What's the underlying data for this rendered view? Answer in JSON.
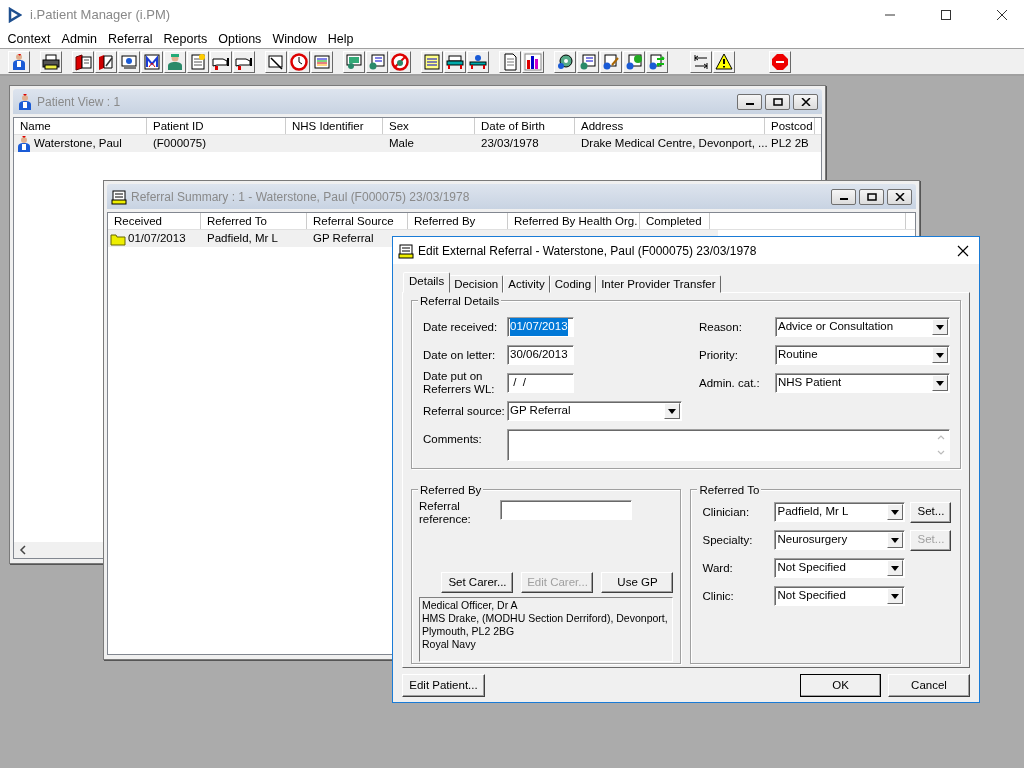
{
  "app": {
    "title": "i.Patient Manager (i.PM)"
  },
  "menu": [
    "Context",
    "Admin",
    "Referral",
    "Reports",
    "Options",
    "Window",
    "Help"
  ],
  "patient_view": {
    "title": "Patient View : 1",
    "columns": [
      "Name",
      "Patient ID",
      "NHS Identifier",
      "Sex",
      "Date of Birth",
      "Address",
      "Postcod"
    ],
    "rows": [
      {
        "selected": true,
        "cells": [
          "Waterstone, Paul",
          "(F000075)",
          null,
          "Male",
          "23/03/1978",
          "Drake Medical Centre, Devonport, ...",
          "PL2 2B"
        ]
      }
    ]
  },
  "referral_summary": {
    "title": "Referral Summary : 1 - Waterstone, Paul (F000075) 23/03/1978",
    "columns": [
      "Received",
      "Referred To",
      "Referral Source",
      "Referred By",
      "Referred By Health Org.",
      "Completed"
    ],
    "rows": [
      {
        "selected": true,
        "cells": [
          "01/07/2013",
          "Padfield, Mr L",
          "GP Referral"
        ]
      }
    ]
  },
  "dialog": {
    "title": "Edit External Referral - Waterstone, Paul (F000075) 23/03/1978",
    "tabs": [
      {
        "label": "Details",
        "selected": true
      },
      {
        "label": "Decision",
        "selected": false
      },
      {
        "label": "Activity",
        "selected": false
      },
      {
        "label": "Coding",
        "selected": false
      },
      {
        "label": "Inter Provider Transfer",
        "selected": false
      }
    ],
    "referral_details": {
      "legend": "Referral Details",
      "left": [
        {
          "kind": "date",
          "label": "Date received:",
          "value": "01/07/2013",
          "highlighted": true
        },
        {
          "kind": "date",
          "label": "Date on letter:",
          "value": "30/06/2013",
          "highlighted": false
        },
        {
          "kind": "date",
          "label": "Date put on Referrers WL:",
          "value": " /  /",
          "highlighted": false
        },
        {
          "kind": "select",
          "label": "Referral source:",
          "value": "GP Referral"
        }
      ],
      "right": [
        {
          "kind": "select",
          "label": "Reason:",
          "value": "Advice or Consultation"
        },
        {
          "kind": "select",
          "label": "Priority:",
          "value": "Routine"
        },
        {
          "kind": "select",
          "label": "Admin. cat.:",
          "value": "NHS Patient"
        }
      ],
      "comments_label": "Comments:"
    },
    "referred_by": {
      "legend": "Referred By",
      "reference_label": "Referral reference:",
      "buttons": [
        {
          "label": "Set Carer...",
          "disabled": false
        },
        {
          "label": "Edit Carer...",
          "disabled": true
        },
        {
          "label": "Use GP",
          "disabled": false
        }
      ],
      "address": [
        "Medical Officer, Dr A",
        "HMS Drake, (MODHU Section Derriford), Devonport,",
        "Plymouth, PL2 2BG",
        "Royal Navy"
      ]
    },
    "referred_to": {
      "legend": "Referred To",
      "rows": [
        {
          "label": "Clinician:",
          "value": "Padfield, Mr L",
          "button": {
            "label": "Set...",
            "disabled": false
          }
        },
        {
          "label": "Specialty:",
          "value": "Neurosurgery",
          "button": {
            "label": "Set...",
            "disabled": true
          }
        },
        {
          "label": "Ward:",
          "value": "Not Specified"
        },
        {
          "label": "Clinic:",
          "value": "Not Specified"
        }
      ]
    },
    "footer": {
      "left_button": "Edit Patient...",
      "ok": "OK",
      "cancel": "Cancel"
    }
  }
}
